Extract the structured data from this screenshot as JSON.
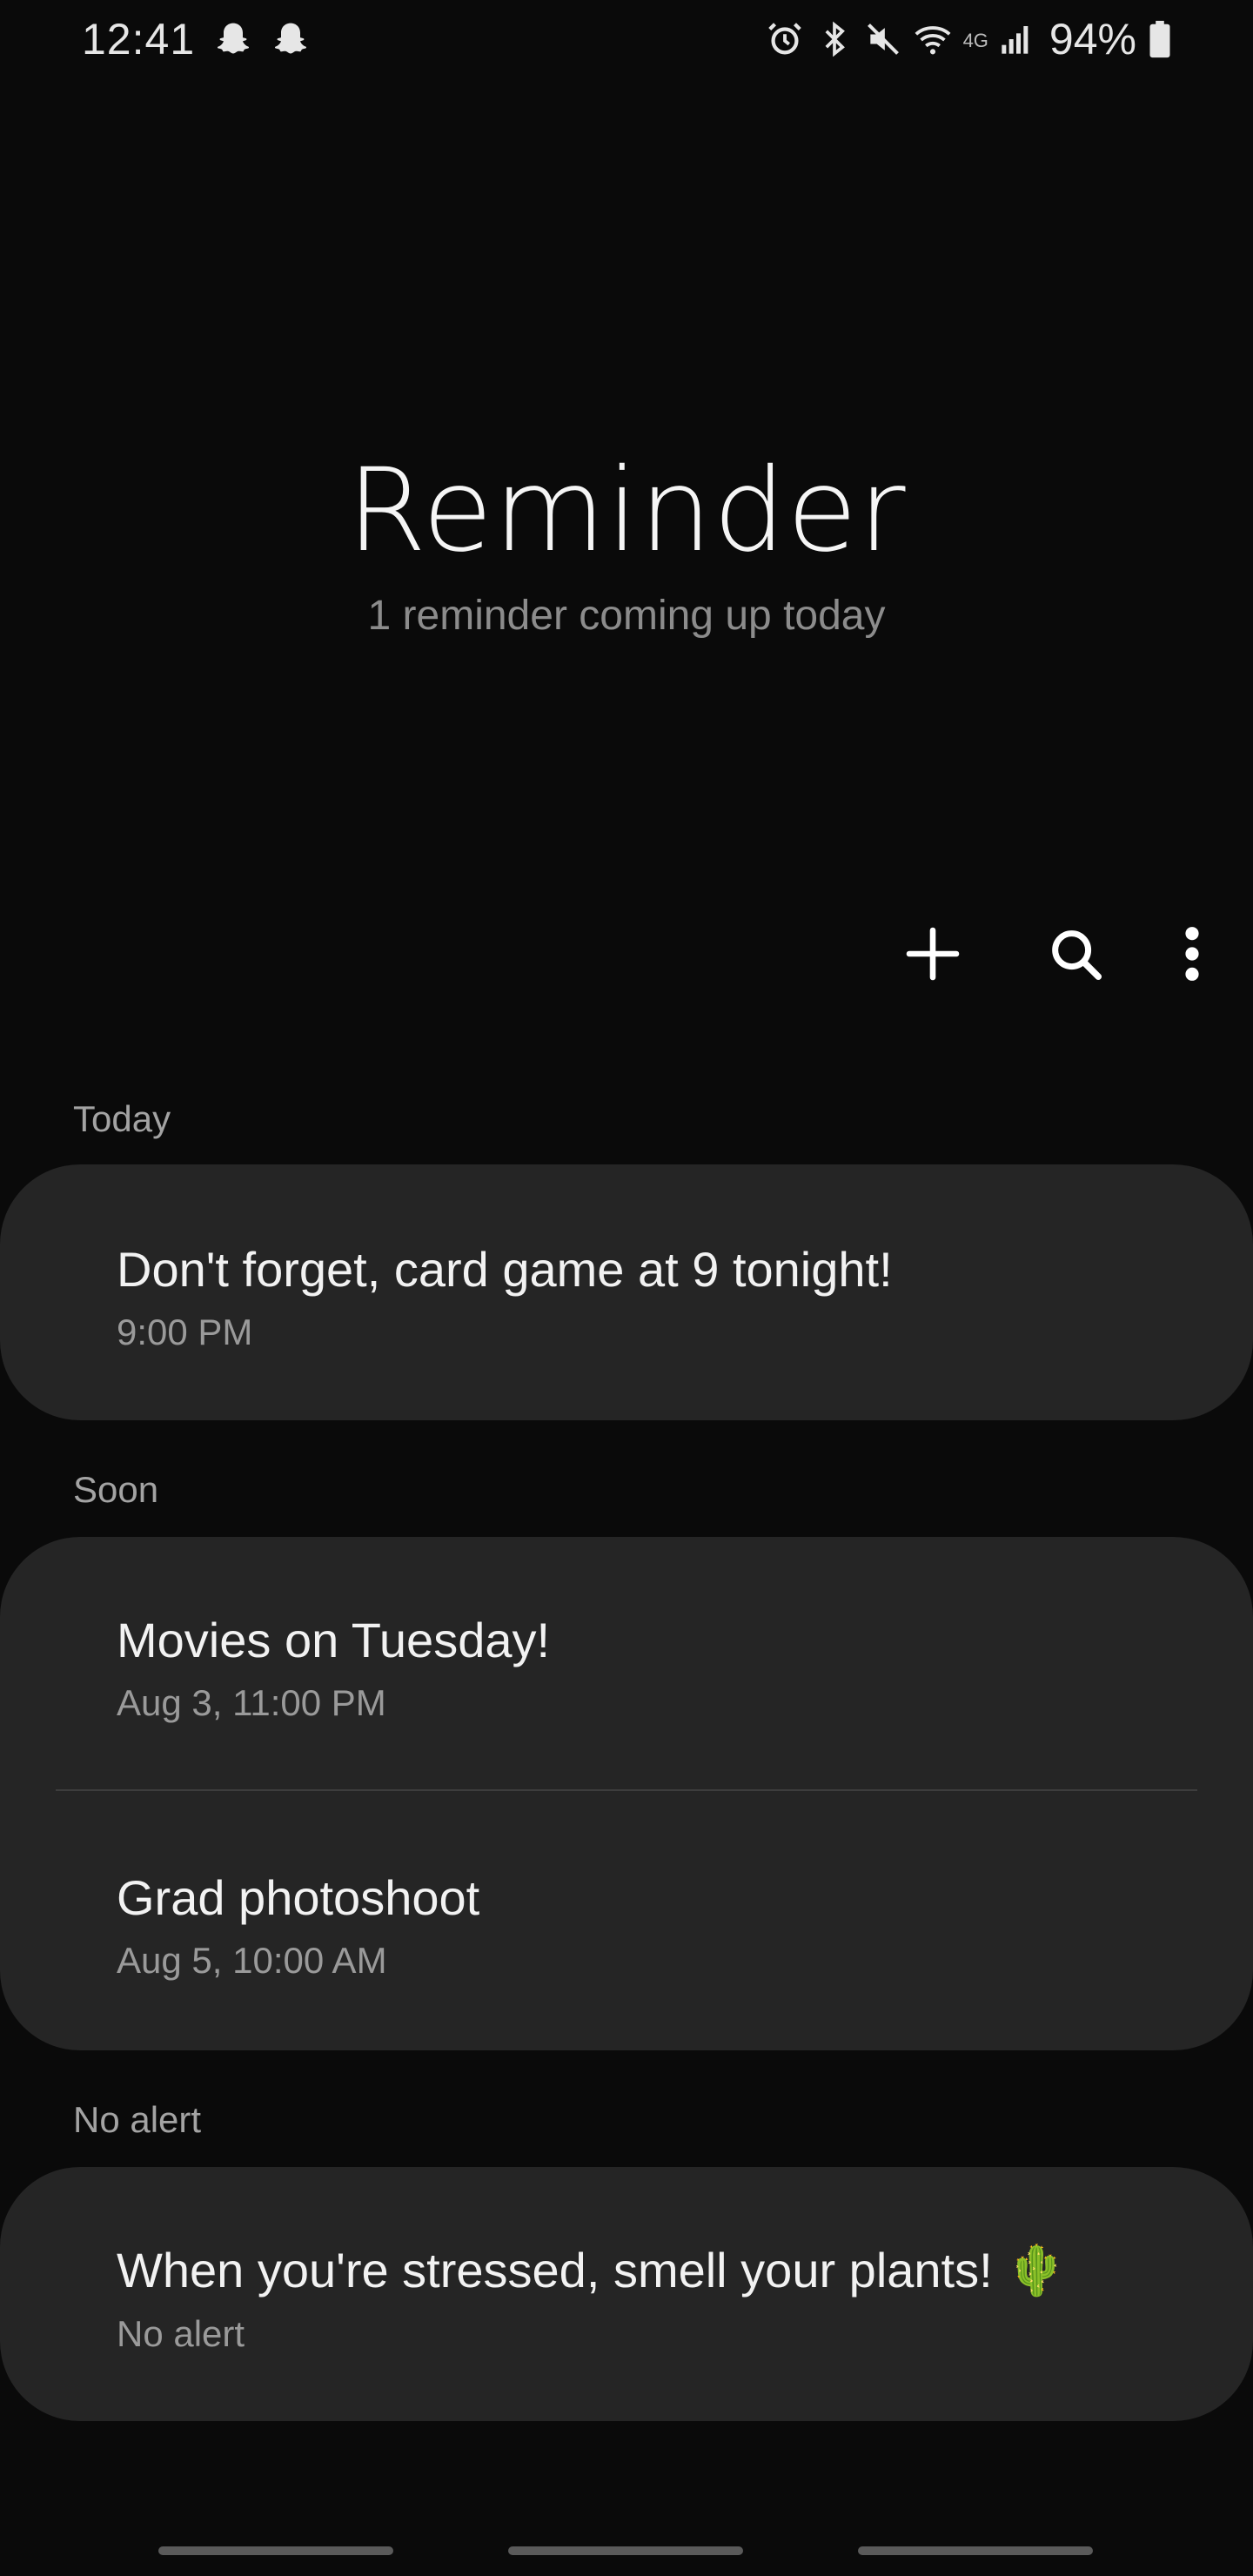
{
  "status_bar": {
    "time": "12:41",
    "battery": "94%",
    "network": "4G",
    "left_icons": [
      "snapchat-icon",
      "snapchat-icon"
    ],
    "right_icons": [
      "alarm-icon",
      "bluetooth-icon",
      "mute-icon",
      "wifi-icon",
      "signal-icon",
      "battery-icon"
    ]
  },
  "header": {
    "title": "Reminder",
    "subtitle": "1 reminder coming up today"
  },
  "toolbar": {
    "icons": [
      "add-icon",
      "search-icon",
      "more-options-icon"
    ]
  },
  "sections": [
    {
      "label": "Today",
      "items": [
        {
          "title": "Don't forget, card game at 9 tonight!",
          "subtitle": "9:00 PM"
        }
      ]
    },
    {
      "label": "Soon",
      "items": [
        {
          "title": "Movies on Tuesday!",
          "subtitle": "Aug 3, 11:00 PM"
        },
        {
          "title": "Grad photoshoot",
          "subtitle": "Aug 5, 10:00 AM"
        }
      ]
    },
    {
      "label": "No alert",
      "items": [
        {
          "title": "When you're stressed, smell your  plants! 🌵",
          "subtitle": "No alert"
        }
      ]
    }
  ],
  "colors": {
    "background": "#0a0a0a",
    "card": "#252525",
    "title_text": "#f2f2f2",
    "secondary_text": "#9a9a9a"
  }
}
